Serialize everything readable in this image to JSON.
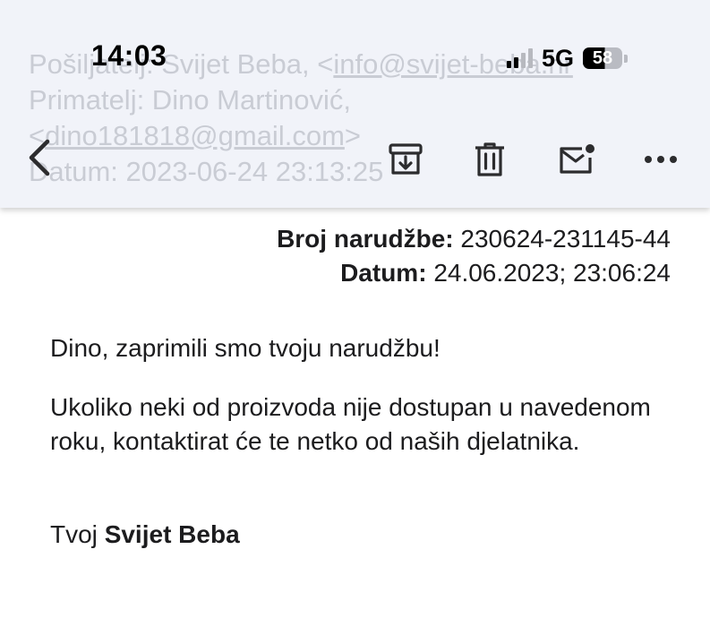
{
  "status_bar": {
    "time": "14:03",
    "network": "5G",
    "battery": "58"
  },
  "background_headers": {
    "sender_label": "Pošiljatelj:",
    "sender_name": "Svijet Beba, <",
    "sender_email": "info@svijet-beba.hr",
    "recipient_line": "Primatelj: Dino Martinović,",
    "recipient_email": "dino181818@gmail.com",
    "date_line": "Datum: 2023-06-24 23:13:25"
  },
  "toolbar": {
    "icons": [
      "back-icon",
      "archive-icon",
      "trash-icon",
      "mark-unread-icon",
      "more-icon"
    ]
  },
  "order": {
    "number_label": "Broj narudžbe:",
    "number_value": "230624-231145-44",
    "date_label": "Datum:",
    "date_value": "24.06.2023; 23:06:24"
  },
  "message": {
    "greeting": "Dino, zaprimili smo tvoju narudžbu!",
    "body": "Ukoliko neki od proizvoda nije dostupan u navedenom roku, kontaktirat će te netko od naših djelatnika.",
    "signoff_prefix": "Tvoj",
    "signoff_name": "Svijet Beba"
  }
}
